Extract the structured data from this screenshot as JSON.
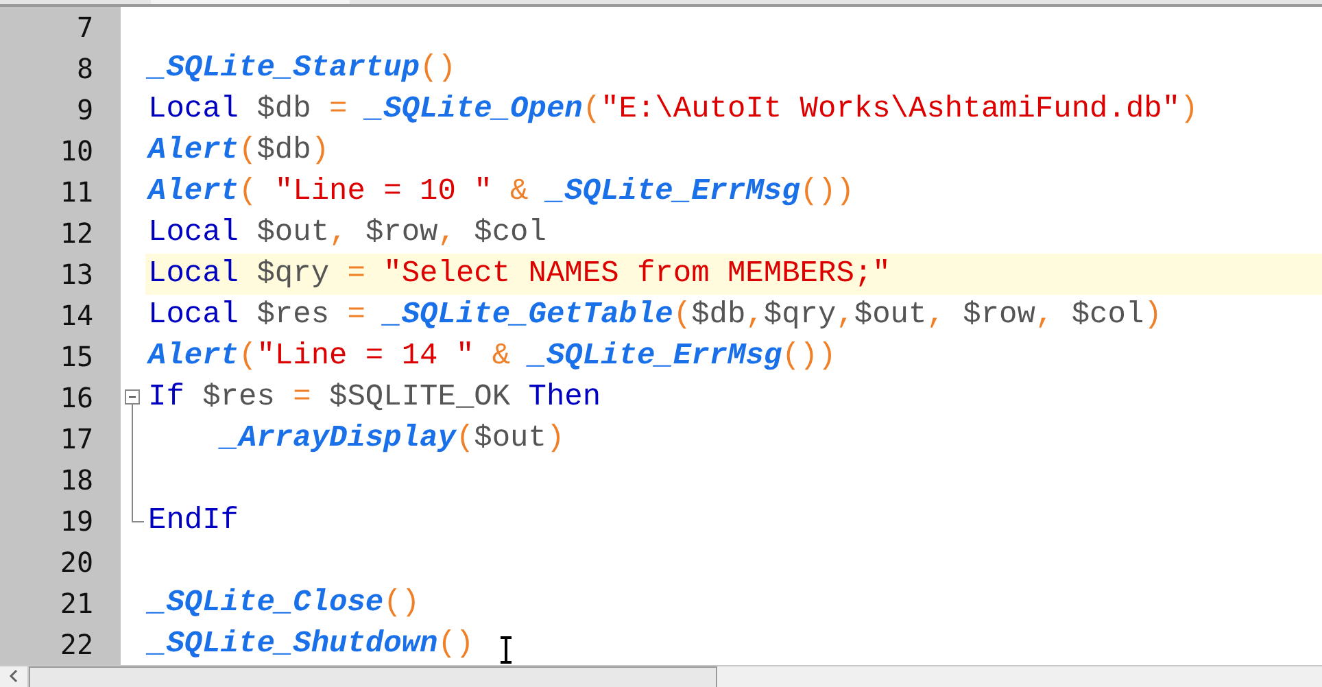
{
  "editor": {
    "lines": [
      {
        "number": "7",
        "current": false
      },
      {
        "number": "8",
        "current": false,
        "tokens": [
          {
            "kind": "func",
            "text": "_SQLite_Startup"
          },
          {
            "kind": "op",
            "text": "()"
          }
        ]
      },
      {
        "number": "9",
        "current": false,
        "tokens": [
          {
            "kind": "keyword",
            "text": "Local"
          },
          {
            "kind": "var",
            "text": " $db"
          },
          {
            "kind": "op",
            "text": " = "
          },
          {
            "kind": "func",
            "text": "_SQLite_Open"
          },
          {
            "kind": "op",
            "text": "("
          },
          {
            "kind": "string",
            "text": "\"E:\\AutoIt Works\\AshtamiFund.db\""
          },
          {
            "kind": "op",
            "text": ")"
          }
        ]
      },
      {
        "number": "10",
        "current": false,
        "tokens": [
          {
            "kind": "func",
            "text": "Alert"
          },
          {
            "kind": "op",
            "text": "("
          },
          {
            "kind": "var",
            "text": "$db"
          },
          {
            "kind": "op",
            "text": ")"
          }
        ]
      },
      {
        "number": "11",
        "current": false,
        "tokens": [
          {
            "kind": "func",
            "text": "Alert"
          },
          {
            "kind": "op",
            "text": "( "
          },
          {
            "kind": "string",
            "text": "\"Line = 10 \""
          },
          {
            "kind": "op",
            "text": " & "
          },
          {
            "kind": "func",
            "text": "_SQLite_ErrMsg"
          },
          {
            "kind": "op",
            "text": "())"
          }
        ]
      },
      {
        "number": "12",
        "current": false,
        "tokens": [
          {
            "kind": "keyword",
            "text": "Local"
          },
          {
            "kind": "var",
            "text": " $out"
          },
          {
            "kind": "op",
            "text": ", "
          },
          {
            "kind": "var",
            "text": "$row"
          },
          {
            "kind": "op",
            "text": ", "
          },
          {
            "kind": "var",
            "text": "$col"
          }
        ]
      },
      {
        "number": "13",
        "current": true,
        "tokens": [
          {
            "kind": "keyword",
            "text": "Local"
          },
          {
            "kind": "var",
            "text": " $qry"
          },
          {
            "kind": "op",
            "text": " = "
          },
          {
            "kind": "string",
            "text": "\"Select NAMES from MEMBERS;\""
          }
        ]
      },
      {
        "number": "14",
        "current": false,
        "tokens": [
          {
            "kind": "keyword",
            "text": "Local"
          },
          {
            "kind": "var",
            "text": " $res"
          },
          {
            "kind": "op",
            "text": " = "
          },
          {
            "kind": "func",
            "text": "_SQLite_GetTable"
          },
          {
            "kind": "op",
            "text": "("
          },
          {
            "kind": "var",
            "text": "$db"
          },
          {
            "kind": "op",
            "text": ","
          },
          {
            "kind": "var",
            "text": "$qry"
          },
          {
            "kind": "op",
            "text": ","
          },
          {
            "kind": "var",
            "text": "$out"
          },
          {
            "kind": "op",
            "text": ", "
          },
          {
            "kind": "var",
            "text": "$row"
          },
          {
            "kind": "op",
            "text": ", "
          },
          {
            "kind": "var",
            "text": "$col"
          },
          {
            "kind": "op",
            "text": ")"
          }
        ]
      },
      {
        "number": "15",
        "current": false,
        "tokens": [
          {
            "kind": "func",
            "text": "Alert"
          },
          {
            "kind": "op",
            "text": "("
          },
          {
            "kind": "string",
            "text": "\"Line = 14 \""
          },
          {
            "kind": "op",
            "text": " & "
          },
          {
            "kind": "func",
            "text": "_SQLite_ErrMsg"
          },
          {
            "kind": "op",
            "text": "())"
          }
        ]
      },
      {
        "number": "16",
        "current": false,
        "expanded": true,
        "tokens": [
          {
            "kind": "keyword",
            "text": "If"
          },
          {
            "kind": "var",
            "text": " $res"
          },
          {
            "kind": "op",
            "text": " = "
          },
          {
            "kind": "var",
            "text": "$SQLITE_OK"
          },
          {
            "kind": "keyword",
            "text": " Then"
          }
        ],
        "children": [
          {
            "number": "17",
            "current": false,
            "tokens": [
              {
                "kind": "func",
                "text": "    _ArrayDisplay"
              },
              {
                "kind": "op",
                "text": "("
              },
              {
                "kind": "var",
                "text": "$out"
              },
              {
                "kind": "op",
                "text": ")"
              }
            ]
          },
          {
            "number": "18",
            "current": false
          },
          {
            "number": "19",
            "current": false,
            "tokens": [
              {
                "kind": "keyword",
                "text": "EndIf"
              }
            ]
          }
        ]
      },
      {
        "number": "20",
        "current": false
      },
      {
        "number": "21",
        "current": false,
        "tokens": [
          {
            "kind": "func",
            "text": "_SQLite_Close"
          },
          {
            "kind": "op",
            "text": "()"
          }
        ]
      },
      {
        "number": "22",
        "current": false,
        "tokens": [
          {
            "kind": "func",
            "text": "_SQLite_Shutdown"
          },
          {
            "kind": "op",
            "text": "()"
          }
        ]
      }
    ]
  }
}
